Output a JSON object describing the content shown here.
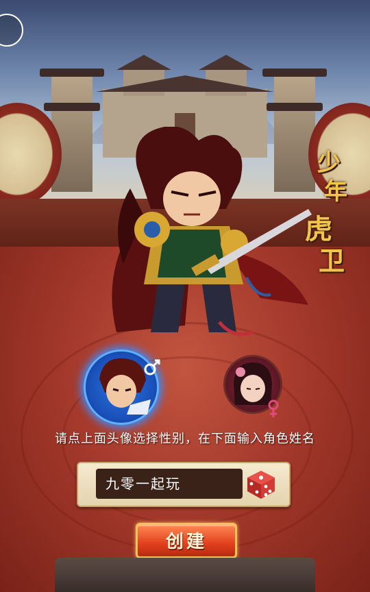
{
  "character_title": [
    "少",
    "年",
    "虎",
    "卫"
  ],
  "instruction": "请点上面头像选择性别，在下面输入角色姓名",
  "name_input": {
    "value": "九零一起玩"
  },
  "create_button": {
    "label": "创建"
  },
  "icons": {
    "corner": "circle-button-icon",
    "male": "male-symbol-icon",
    "female": "female-symbol-icon",
    "dice": "dice-icon"
  },
  "colors": {
    "title_gold": "#f2c54a",
    "male_glow": "#3a8cff",
    "button_red": "#e2401e",
    "panel": "#f5ead0"
  }
}
